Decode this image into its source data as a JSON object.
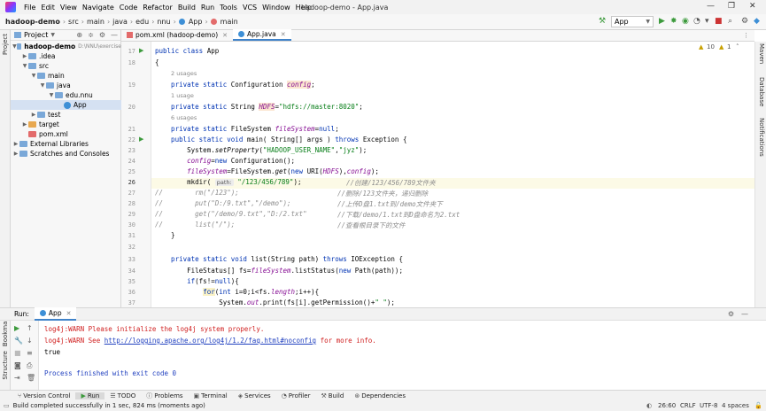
{
  "menu": {
    "items": [
      "File",
      "Edit",
      "View",
      "Navigate",
      "Code",
      "Refactor",
      "Build",
      "Run",
      "Tools",
      "VCS",
      "Window",
      "Help"
    ],
    "title": "hadoop-demo - App.java"
  },
  "breadcrumb": [
    "hadoop-demo",
    "src",
    "main",
    "java",
    "edu",
    "nnu",
    "App",
    "main"
  ],
  "run_config": "App",
  "project_panel": {
    "label": "Project",
    "tree": [
      {
        "label": "hadoop-demo",
        "extra": "D:\\NNU\\exercise"
      },
      {
        "label": ".idea"
      },
      {
        "label": "src"
      },
      {
        "label": "main"
      },
      {
        "label": "java"
      },
      {
        "label": "edu.nnu"
      },
      {
        "label": "App"
      },
      {
        "label": "test"
      },
      {
        "label": "target"
      },
      {
        "label": "pom.xml"
      },
      {
        "label": "External Libraries"
      },
      {
        "label": "Scratches and Consoles"
      }
    ]
  },
  "side_labels": {
    "left_top": "Project",
    "left_bottom_1": "Bookmarks",
    "left_bottom_2": "Structure",
    "right_1": "Maven",
    "right_2": "Database",
    "right_3": "Notifications"
  },
  "tabs": [
    {
      "label": "pom.xml (hadoop-demo)"
    },
    {
      "label": "App.java"
    }
  ],
  "inspections": {
    "warnings": "10",
    "weak": "1"
  },
  "code": {
    "line_numbers": [
      "17",
      "18",
      "19",
      "20",
      "21",
      "22",
      "23",
      "24",
      "25",
      "26",
      "27",
      "28",
      "29",
      "30",
      "31",
      "32",
      "33",
      "34",
      "35",
      "36",
      "37"
    ],
    "hints": {
      "h1": "2 usages",
      "h2": "1 usage",
      "h3": "6 usages"
    },
    "l17a": "public class ",
    "l17b": "App",
    "l18": "{",
    "l19a": "    private static ",
    "l19b": "Configuration ",
    "l19c": "config",
    "l19d": ";",
    "l20a": "    private static ",
    "l20b": "String ",
    "l20c": "HDFS",
    "l20d": "=",
    "l20e": "\"hdfs://master:8020\"",
    "l20f": ";",
    "l21a": "    private static ",
    "l21b": "FileSystem ",
    "l21c": "fileSystem",
    "l21d": "=",
    "l21e": "null",
    "l21f": ";",
    "l22a": "    public static void ",
    "l22b": "main( String[] args ) ",
    "l22c": "throws ",
    "l22d": "Exception {",
    "l23a": "        System.",
    "l23b": "setProperty",
    "l23c": "(",
    "l23d": "\"HADOOP_USER_NAME\"",
    "l23e": ",",
    "l23f": "\"jyz\"",
    "l23g": ");",
    "l24a": "        ",
    "l24b": "config",
    "l24c": "=",
    "l24d": "new ",
    "l24e": "Configuration();",
    "l25a": "        ",
    "l25b": "fileSystem",
    "l25c": "=FileSystem.",
    "l25d": "get",
    "l25e": "(",
    "l25f": "new ",
    "l25g": "URI(",
    "l25h": "HDFS",
    "l25i": "),",
    "l25j": "config",
    "l25k": ");",
    "l26a": "        mkdir( ",
    "l26hint": "path:",
    "l26b": " \"/123/456/789\"",
    "l26c": ");",
    "l26d": "//创建/123/456/789文件夹",
    "l27a": "//",
    "l27b": "        rm(\"/123\");",
    "l27c": "//删除/123文件夹，递归删除",
    "l28a": "//",
    "l28b": "        put(\"D:/9.txt\",\"/demo\");",
    "l28c": "//上传D盘1.txt到/demo文件夹下",
    "l29a": "//",
    "l29b": "        get(\"/demo/9.txt\",\"D:/2.txt\"",
    "l29c": "//下载/demo/1.txt到D盘命名为2.txt",
    "l30a": "//",
    "l30b": "        list(\"/\");",
    "l30c": "//查看根目录下的文件",
    "l31": "    }",
    "l32": "",
    "l33a": "    private static void ",
    "l33b": "list",
    "l33c": "(String path) ",
    "l33d": "throws ",
    "l33e": "IOException {",
    "l34a": "        FileStatus[] fs=",
    "l34b": "fileSystem",
    "l34c": ".listStatus(",
    "l34d": "new ",
    "l34e": "Path(path));",
    "l35a": "        ",
    "l35b": "if",
    "l35c": "(fs!=",
    "l35d": "null",
    "l35e": "){",
    "l36a": "            ",
    "l36b": "for",
    "l36c": "(",
    "l36d": "int ",
    "l36e": "i=0;i<fs.",
    "l36f": "length",
    "l36g": ";i++){",
    "l37a": "                System.",
    "l37b": "out",
    "l37c": ".print(fs[i].getPermission()+",
    "l37d": "\" \"",
    "l37e": ");"
  },
  "run_panel": {
    "label": "Run:",
    "tab": "App",
    "lines": {
      "w1": "log4j:WARN Please initialize the log4j system properly.",
      "w2a": "log4j:WARN See ",
      "w2b": "http://logging.apache.org/log4j/1.2/faq.html#noconfig",
      "w2c": " for more info.",
      "out": "true",
      "exit": "Process finished with exit code 0"
    }
  },
  "tool_windows": [
    "Version Control",
    "Run",
    "TODO",
    "Problems",
    "Terminal",
    "Services",
    "Profiler",
    "Build",
    "Dependencies"
  ],
  "status": {
    "message": "Build completed successfully in 1 sec, 824 ms (moments ago)",
    "position": "26:60",
    "line_sep": "CRLF",
    "encoding": "UTF-8",
    "indent": "4 spaces"
  },
  "colors": {
    "accent": "#4083c9",
    "keyword": "#0033b3",
    "string": "#067d17",
    "field": "#871094",
    "warn": "#d02020"
  }
}
